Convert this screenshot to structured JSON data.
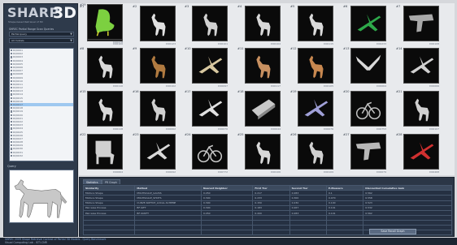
{
  "app": {
    "logo_text": "SHARP",
    "logo_3d": "3D",
    "tagline": "Shape-based Retrieval of 3D"
  },
  "left": {
    "benchmark_label": "SHREC Partial Range Scan Queries",
    "benchmark_select": "Partial query",
    "model_label": "All models",
    "models": [
      "RQ0001",
      "RQ0002",
      "RQ0003",
      "RQ0004",
      "RQ0005",
      "RQ0006",
      "RQ0007",
      "RQ0008",
      "RQ0009",
      "RQ0010",
      "RQ0011",
      "RQ0012",
      "RQ0013",
      "RQ0014",
      "RQ0015",
      "RQ0016",
      "RQ0017",
      "RQ0018",
      "RQ0019",
      "RQ0020",
      "RQ0021",
      "RQ0022",
      "RQ0023",
      "RQ0024",
      "RQ0025",
      "RQ0026",
      "RQ0027",
      "RQ0028",
      "RQ0029",
      "RQ0030",
      "RQ0031",
      "RQ0032"
    ],
    "selected_index": 16,
    "query_label": "Query"
  },
  "grid": {
    "results": [
      {
        "num": "#1",
        "id": "D00100",
        "shape": "horse",
        "color": "#d8d8d8"
      },
      {
        "num": "#2",
        "id": "D00123",
        "shape": "horse",
        "color": "#e0e0e0"
      },
      {
        "num": "#3",
        "id": "D00101",
        "shape": "horse",
        "color": "#d0d0d0"
      },
      {
        "num": "#4",
        "id": "D00104",
        "shape": "horse",
        "color": "#d8d8d8"
      },
      {
        "num": "#5",
        "id": "D00115",
        "shape": "horse",
        "color": "#dadada"
      },
      {
        "num": "#6",
        "id": "D00233",
        "shape": "plane",
        "color": "#2ea84a"
      },
      {
        "num": "#7",
        "id": "D00108",
        "shape": "gun",
        "color": "#a8a8a8"
      },
      {
        "num": "#8",
        "id": "D00110",
        "shape": "horse",
        "color": "#d8d8d8"
      },
      {
        "num": "#9",
        "id": "D00102",
        "shape": "horse",
        "color": "#b07a40"
      },
      {
        "num": "#10",
        "id": "D00097",
        "shape": "plane",
        "color": "#d8c8a0"
      },
      {
        "num": "#11",
        "id": "D00117",
        "shape": "horse",
        "color": "#c89060"
      },
      {
        "num": "#12",
        "id": "D00105",
        "shape": "horse",
        "color": "#c88850"
      },
      {
        "num": "#13",
        "id": "D00064",
        "shape": "bird",
        "color": "#d8d8d8"
      },
      {
        "num": "#14",
        "id": "D00066",
        "shape": "plane",
        "color": "#d0d0d0"
      },
      {
        "num": "#15",
        "id": "D00118",
        "shape": "horse",
        "color": "#d8d8d8"
      },
      {
        "num": "#16",
        "id": "D00062",
        "shape": "horse",
        "color": "#d0d0d0"
      },
      {
        "num": "#17",
        "id": "D00070",
        "shape": "plane",
        "color": "#e0e0e0"
      },
      {
        "num": "#18",
        "id": "D00044",
        "shape": "block",
        "color": "#c8c8c8"
      },
      {
        "num": "#19",
        "id": "D00076",
        "shape": "plane",
        "color": "#a0a0d8"
      },
      {
        "num": "#20",
        "id": "D00753",
        "shape": "bike",
        "color": "#c0c0c0"
      },
      {
        "num": "#21",
        "id": "D00107",
        "shape": "horse",
        "color": "#d0d0d0"
      },
      {
        "num": "#22",
        "id": "D00664",
        "shape": "chair",
        "color": "#d0d0d0"
      },
      {
        "num": "#23",
        "id": "D00092",
        "shape": "plane",
        "color": "#d8d8d8"
      },
      {
        "num": "#24",
        "id": "D00772",
        "shape": "bike",
        "color": "#c8c8c8"
      },
      {
        "num": "#25",
        "id": "D00106",
        "shape": "horse",
        "color": "#d8d8d8"
      },
      {
        "num": "#26",
        "id": "D00109",
        "shape": "horse",
        "color": "#d0d0d0"
      },
      {
        "num": "#27",
        "id": "D00079",
        "shape": "gun",
        "color": "#b8b8b8"
      },
      {
        "num": "#28",
        "id": "D00468",
        "shape": "plane",
        "color": "#d03030"
      },
      {
        "num": "#29",
        "id": "D00478",
        "shape": "chairgreen",
        "color": "#7cd040"
      }
    ]
  },
  "tabs": [
    {
      "label": "Statistics"
    },
    {
      "label": "PR Graph"
    }
  ],
  "table": {
    "headers": [
      "Similarity",
      "Method",
      "Nearest Neighbor",
      "First Tier",
      "Second Tier",
      "E-Measure",
      "Discounted Cumulative Gain"
    ],
    "rows": [
      [
        "Mixture Shape",
        "MULTISCALE_GAUSS",
        "0.450",
        "0.217",
        "0.283",
        "0.1",
        "0.562"
      ],
      [
        "Mixture Shape",
        "MULTISCALE_SHOTS",
        "0.390",
        "0.233",
        "0.300",
        "0.070",
        "0.558"
      ],
      [
        "Mixture Shape",
        "CURVE-SKETCH_LOCAL-SCHEME",
        "0.390",
        "0.150",
        "0.230",
        "0.100",
        "0.523"
      ],
      [
        "Pair-wise Process",
        "BF-SIFT",
        "0.390",
        "0.183",
        "0.267",
        "0.101",
        "0.532"
      ],
      [
        "Pair-wise Process",
        "BF-SURFT",
        "0.450",
        "0.200",
        "0.283",
        "0.101",
        "0.562"
      ]
    ],
    "empty_rows": 4
  },
  "save_button": "Save Recall Graph",
  "footer": {
    "line1": "SHREC 2009 Shape Retrieval Contest of Partial 3D Models - Query Benchmark",
    "line2": "Visual Computing Lab - ISTI-CNR"
  }
}
